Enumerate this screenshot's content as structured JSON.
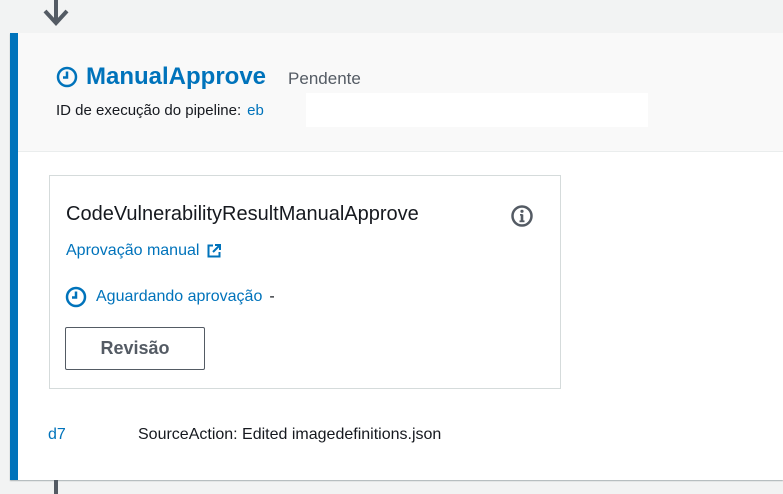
{
  "stage": {
    "action_group_name": "ManualApprove",
    "status": "Pendente",
    "execution_label": "ID de execução do pipeline:",
    "execution_id": "eb"
  },
  "action": {
    "name": "CodeVulnerabilityResultManualApprove",
    "provider": "Aprovação manual",
    "status": "Aguardando aprovação",
    "status_suffix": "-",
    "review_label": "Revisão"
  },
  "revision": {
    "id": "d7",
    "message": "SourceAction: Edited imagedefinitions.json"
  },
  "icons": {
    "connector_top": "arrow-down-icon",
    "title": "clock-icon",
    "info": "info-circle-icon",
    "external": "external-link-icon",
    "status": "clock-icon"
  },
  "colors": {
    "accent": "#0073bb",
    "text": "#16191f",
    "muted": "#545b64",
    "background": "#f2f3f3"
  }
}
